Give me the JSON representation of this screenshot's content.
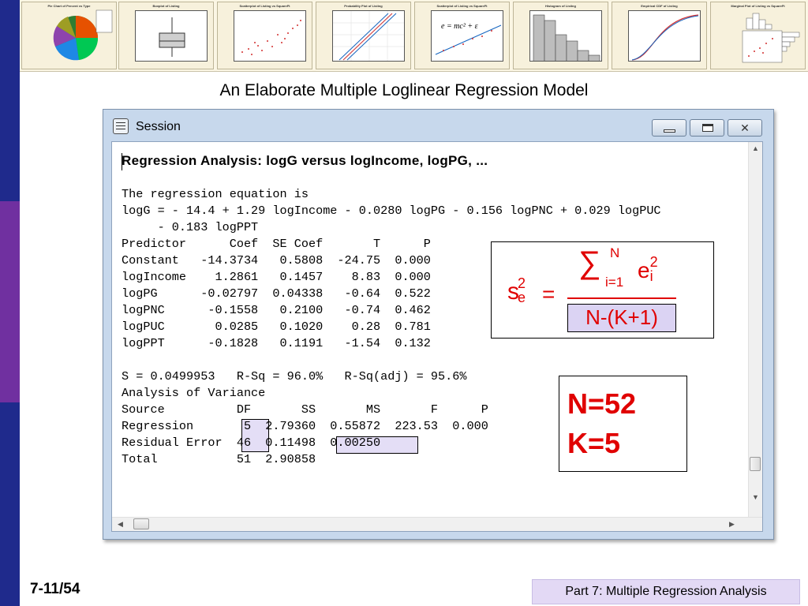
{
  "title": "An Elaborate Multiple Loglinear Regression Model",
  "thumbnails": [
    {
      "title": "Pie Chart of Percent vs Type"
    },
    {
      "title": "Boxplot of Listing"
    },
    {
      "title": "Scatterplot of Listing vs SquareFt"
    },
    {
      "title": "Probability Plot of Listing"
    },
    {
      "title": "Scatterplot of Listing vs SquareFt"
    },
    {
      "title": "Histogram of Listing"
    },
    {
      "title": "Empirical CDF of Listing"
    },
    {
      "title": "Marginal Plot of Listing vs SquareFt"
    }
  ],
  "window": {
    "title": "Session",
    "minimize_glyph": "▁",
    "maximize_glyph": "□",
    "close_glyph": "✕"
  },
  "session": {
    "heading": "Regression Analysis: logG versus logIncome, logPG, ...",
    "eq_intro": "The regression equation is",
    "eq_line1": "logG = - 14.4 + 1.29 logIncome - 0.0280 logPG - 0.156 logPNC + 0.029 logPUC",
    "eq_line2": "     - 0.183 logPPT",
    "coef_header": "Predictor      Coef  SE Coef       T      P",
    "coef_rows": [
      "Constant   -14.3734   0.5808  -24.75  0.000",
      "logIncome    1.2861   0.1457    8.83  0.000",
      "logPG      -0.02797  0.04338   -0.64  0.522",
      "logPNC      -0.1558   0.2100   -0.74  0.462",
      "logPUC       0.0285   0.1020    0.28  0.781",
      "logPPT      -0.1828   0.1191   -1.54  0.132"
    ],
    "fit_line": "S = 0.0499953   R-Sq = 96.0%   R-Sq(adj) = 95.6%",
    "anova_title": "Analysis of Variance",
    "anova_header": "Source          DF       SS       MS       F      P",
    "anova_rows": [
      "Regression       5  2.79360  0.55872  223.53  0.000",
      "Residual Error  46  0.11498  0.00250",
      "Total           51  2.90858"
    ]
  },
  "formula": {
    "lhs": "s",
    "lhs_sup": "2",
    "lhs_sub": "e",
    "equals": "=",
    "sigma": "∑",
    "upper": "N",
    "lower": "i=1",
    "term": "e",
    "term_sup": "2",
    "term_sub": "i",
    "denominator": "N-(K+1)"
  },
  "nk": {
    "line1": "N=52",
    "line2": "K=5"
  },
  "slide_number": "7-11/54",
  "footer": "Part 7: Multiple Regression Analysis",
  "colors": {
    "accent": "#e00000",
    "stripe_blue": "#1f2a8c",
    "stripe_purple": "#7030a0",
    "highlight": "#d2c8f0"
  }
}
